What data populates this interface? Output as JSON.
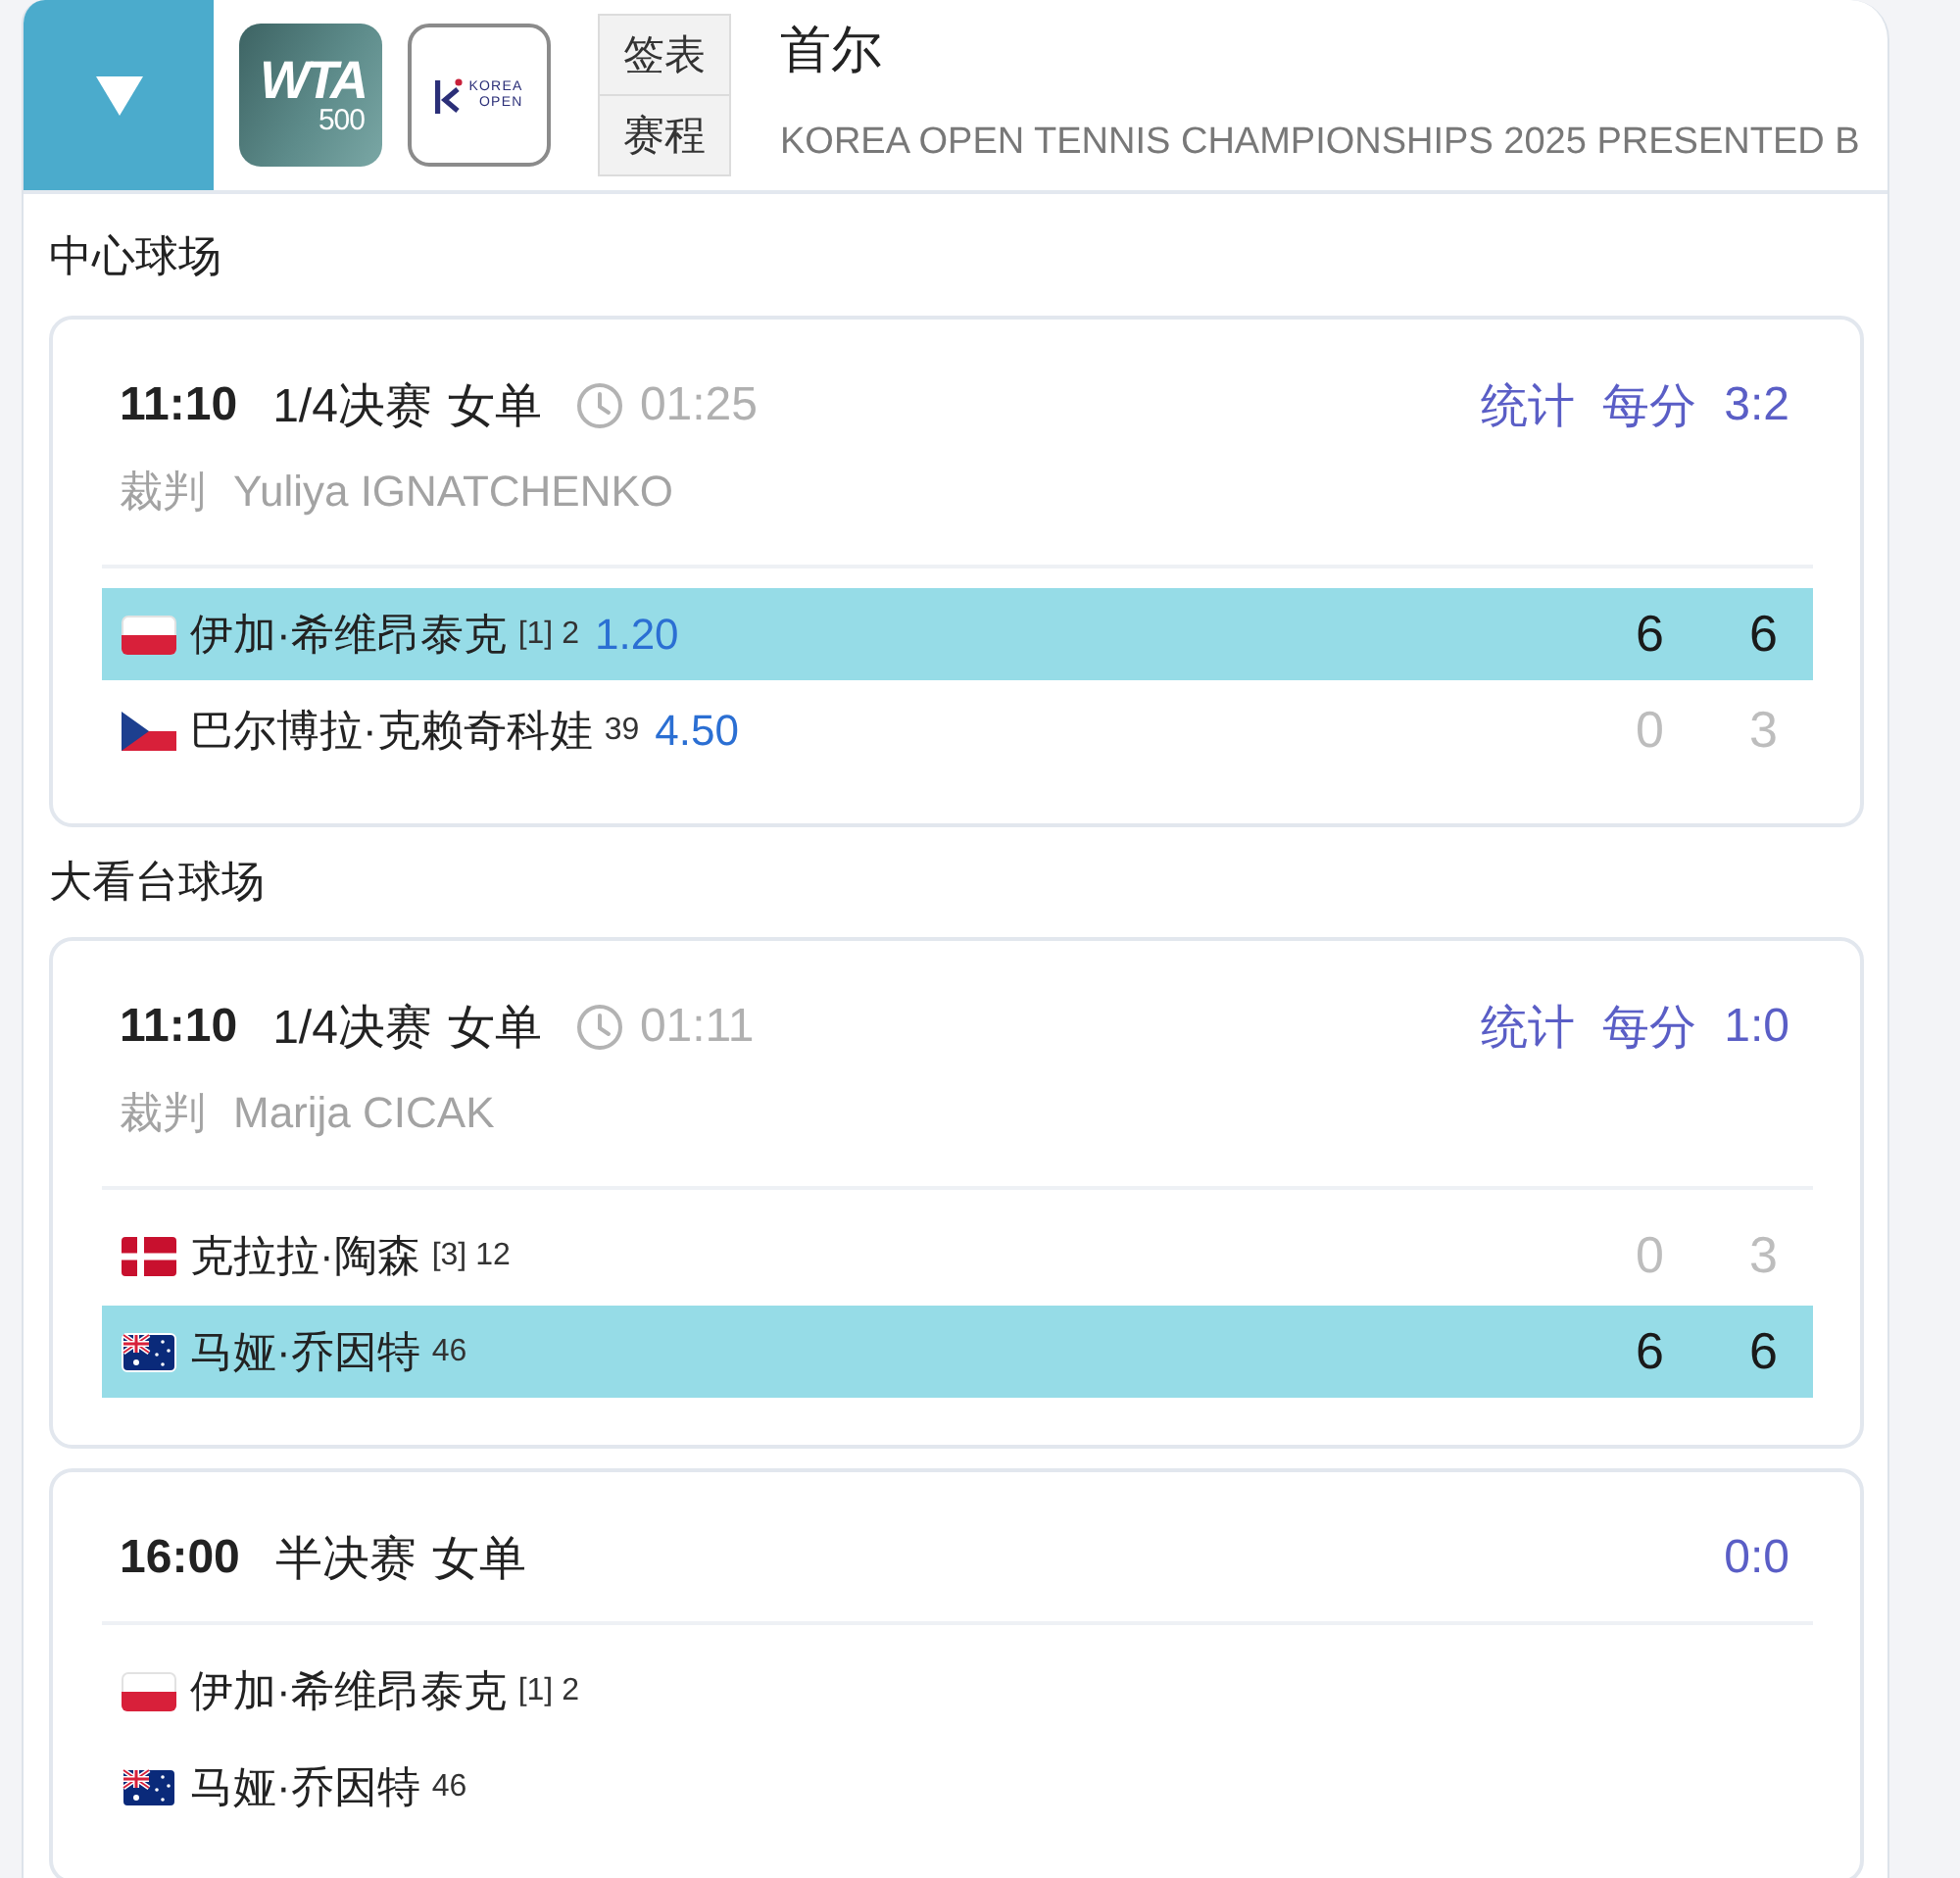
{
  "header": {
    "logos": [
      {
        "kind": "wta",
        "lines": [
          "WTA",
          "500"
        ]
      },
      {
        "kind": "korea_open",
        "lines": [
          "KOREA",
          "OPEN"
        ]
      }
    ],
    "buttons": [
      "签表",
      "赛程"
    ],
    "title": "首尔",
    "subtitle": "KOREA OPEN TENNIS CHAMPIONSHIPS 2025 PRESENTED B"
  },
  "courts": [
    {
      "name": "中心球场",
      "matches": [
        {
          "time": "11:10",
          "round": "1/4决赛",
          "event": "女单",
          "duration": "01:25",
          "links": [
            "统计",
            "每分"
          ],
          "score": "3:2",
          "referee_label": "裁判",
          "referee": "Yuliya IGNATCHENKO",
          "players": [
            {
              "kind": "poland",
              "name": "伊加·希维昂泰克",
              "seeding": "[1] 2",
              "odds": "1.20",
              "winner": true,
              "sets": [
                "6",
                "6"
              ]
            },
            {
              "kind": "czechia",
              "name": "巴尔博拉·克赖奇科娃",
              "seeding": "39",
              "odds": "4.50",
              "winner": false,
              "sets": [
                "0",
                "3"
              ]
            }
          ]
        }
      ]
    },
    {
      "name": "大看台球场",
      "matches": [
        {
          "time": "11:10",
          "round": "1/4决赛",
          "event": "女单",
          "duration": "01:11",
          "links": [
            "统计",
            "每分"
          ],
          "score": "1:0",
          "referee_label": "裁判",
          "referee": "Marija CICAK",
          "players": [
            {
              "kind": "denmark",
              "name": "克拉拉·陶森",
              "seeding": "[3] 12",
              "winner": false,
              "sets": [
                "0",
                "3"
              ]
            },
            {
              "kind": "australia",
              "name": "马娅·乔因特",
              "seeding": "46",
              "winner": true,
              "sets": [
                "6",
                "6"
              ]
            }
          ]
        },
        {
          "time": "16:00",
          "round": "半决赛",
          "event": "女单",
          "score": "0:0",
          "players": [
            {
              "kind": "poland",
              "name": "伊加·希维昂泰克",
              "seeding": "[1] 2",
              "winner": false
            },
            {
              "kind": "australia",
              "name": "马娅·乔因特",
              "seeding": "46",
              "winner": false
            }
          ]
        }
      ]
    }
  ]
}
